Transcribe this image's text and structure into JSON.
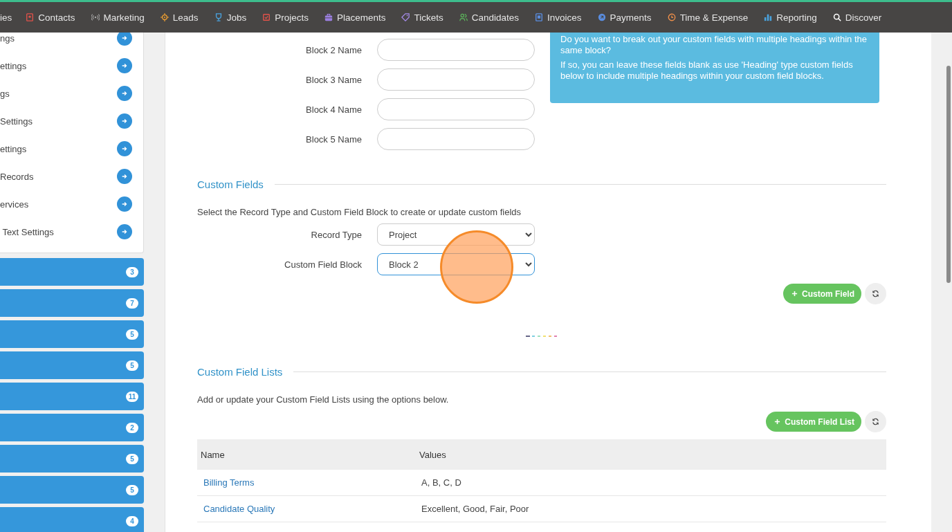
{
  "nav": {
    "items": [
      {
        "label": "ies"
      },
      {
        "label": "Contacts"
      },
      {
        "label": "Marketing"
      },
      {
        "label": "Leads"
      },
      {
        "label": "Jobs"
      },
      {
        "label": "Projects"
      },
      {
        "label": "Placements"
      },
      {
        "label": "Tickets"
      },
      {
        "label": "Candidates"
      },
      {
        "label": "Invoices"
      },
      {
        "label": "Payments"
      },
      {
        "label": "Time & Expense"
      },
      {
        "label": "Reporting"
      },
      {
        "label": "Discover"
      }
    ]
  },
  "sidebar": {
    "items": [
      {
        "label": "ngs"
      },
      {
        "label": "ettings"
      },
      {
        "label": "gs"
      },
      {
        "label": "Settings"
      },
      {
        "label": "ettings"
      },
      {
        "label": "Records"
      },
      {
        "label": "ervices"
      },
      {
        "label": " Text Settings"
      }
    ],
    "groups": [
      {
        "count": "3"
      },
      {
        "count": "7"
      },
      {
        "count": "5"
      },
      {
        "count": "5"
      },
      {
        "count": "11"
      },
      {
        "count": "2"
      },
      {
        "count": "5"
      },
      {
        "count": "5"
      },
      {
        "count": "4"
      }
    ]
  },
  "blocks": {
    "fields": [
      {
        "label": "Block 2 Name"
      },
      {
        "label": "Block 3 Name"
      },
      {
        "label": "Block 4 Name"
      },
      {
        "label": "Block 5 Name"
      }
    ],
    "info": [
      "Do you want to break out your custom fields with multiple headings within the same block?",
      "If so, you can leave these fields blank as use 'Heading' type custom fields below to include multiple headings within your custom field blocks."
    ]
  },
  "custom_fields": {
    "heading": "Custom Fields",
    "description": "Select the Record Type and Custom Field Block to create or update custom fields",
    "selects": [
      {
        "label": "Record Type",
        "value": "Project",
        "focused": false
      },
      {
        "label": "Custom Field Block",
        "value": "Block 2",
        "focused": true
      }
    ],
    "add_button": "Custom Field"
  },
  "custom_field_lists": {
    "heading": "Custom Field Lists",
    "description": "Add or update your Custom Field Lists using the options below.",
    "add_button": "Custom Field List",
    "table": {
      "columns": [
        "Name",
        "Values"
      ],
      "rows": [
        {
          "name": "Billing Terms",
          "values": "A, B, C, D"
        },
        {
          "name": "Candidate Quality",
          "values": "Excellent, Good, Fair, Poor"
        }
      ]
    }
  }
}
